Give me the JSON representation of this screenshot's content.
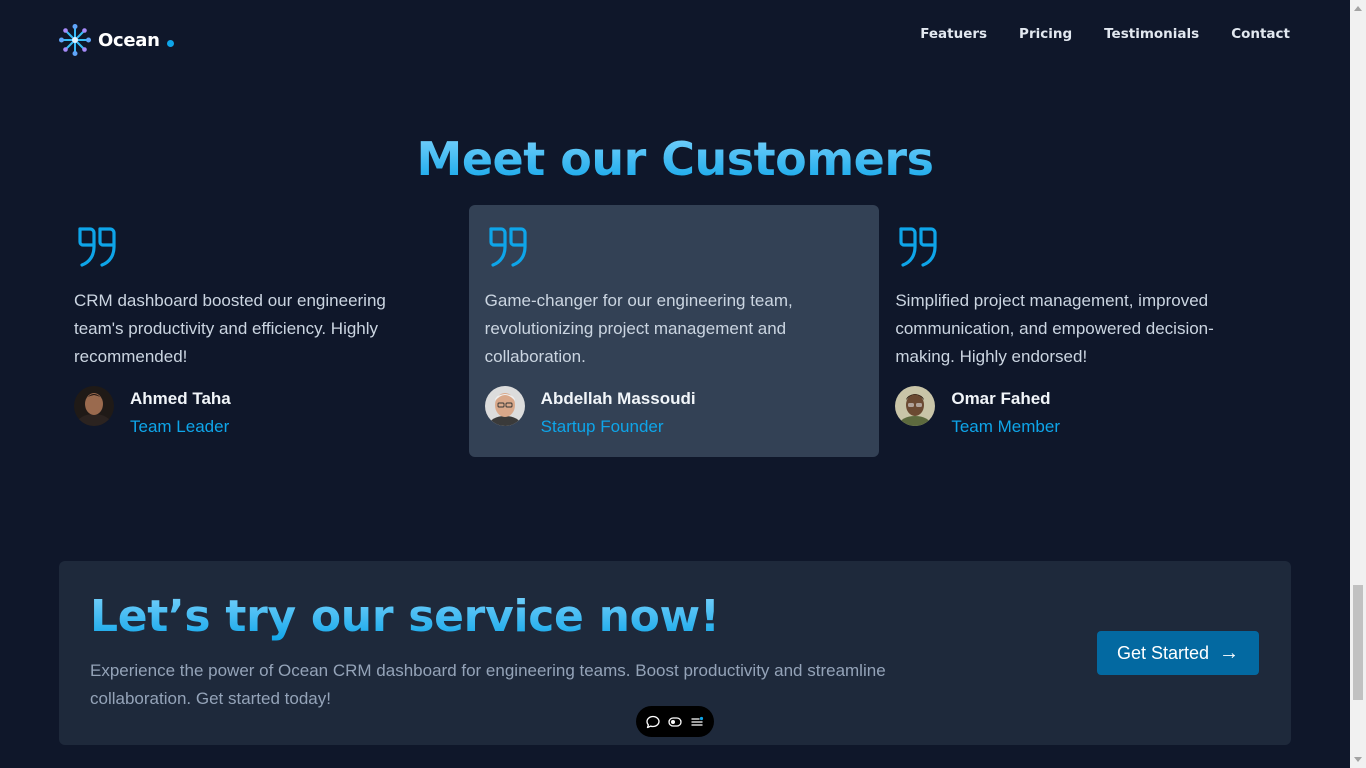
{
  "nav": {
    "brand": "Ocean",
    "links": [
      "Featuers",
      "Pricing",
      "Testimonials",
      "Contact"
    ]
  },
  "testimonials": {
    "title": "Meet our Customers",
    "items": [
      {
        "text": "CRM dashboard boosted our engineering team's productivity and efficiency. Highly recommended!",
        "name": "Ahmed Taha",
        "role": "Team Leader"
      },
      {
        "text": "Game-changer for our engineering team, revolutionizing project management and collaboration.",
        "name": "Abdellah Massoudi",
        "role": "Startup Founder"
      },
      {
        "text": "Simplified project management, improved communication, and empowered decision-making. Highly endorsed!",
        "name": "Omar Fahed",
        "role": "Team Member"
      }
    ]
  },
  "cta": {
    "title": "Let’s try our service now!",
    "text": "Experience the power of Ocean CRM dashboard for engineering teams. Boost productivity and streamline collaboration. Get started today!",
    "button_label": "Get Started",
    "button_icon": "→"
  },
  "colors": {
    "background": "#0f172a",
    "accent": "#0ea5e9",
    "card_active": "#334155",
    "cta_background": "#1e293b",
    "button": "#0369a1"
  }
}
